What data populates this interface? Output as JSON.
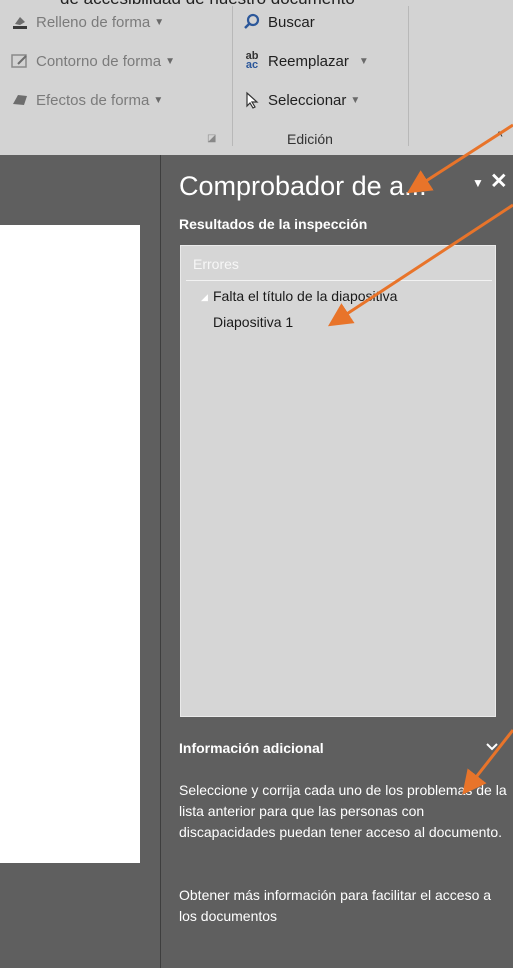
{
  "top_text": "de accesibilidad de nuestro documento",
  "ribbon": {
    "shape_fill": "Relleno de forma",
    "shape_outline": "Contorno de forma",
    "shape_effects": "Efectos de forma",
    "find": "Buscar",
    "replace": "Reemplazar",
    "select": "Seleccionar",
    "editing_group": "Edición",
    "find_icon_glyph": "⌕",
    "replace_icon_glyph": "ab",
    "select_icon_glyph": "⇱",
    "collapse_glyph": "^"
  },
  "pane": {
    "title": "Comprobador de a...",
    "menu_glyph": "▼",
    "close_glyph": "✕",
    "results_label": "Resultados de la inspección",
    "category": "Errores",
    "issue": "Falta el título de la diapositiva",
    "issue_location": "Diapositiva 1",
    "info_title": "Información adicional",
    "info_body": "Seleccione y corrija cada uno de los problemas de la lista anterior para que las personas con discapacidades puedan tener acceso al documento.",
    "info_link": "Obtener más información para facilitar el acceso a los documentos"
  },
  "colors": {
    "ribbon_bg": "#d3d3d3",
    "pane_bg": "#5f5f5f",
    "results_bg": "#d6d6d6",
    "annotation_arrow": "#e8742a"
  },
  "icons": [
    "paint-bucket-icon",
    "outline-pen-icon",
    "shape-effects-icon",
    "search-icon",
    "replace-icon",
    "select-cursor-icon"
  ]
}
